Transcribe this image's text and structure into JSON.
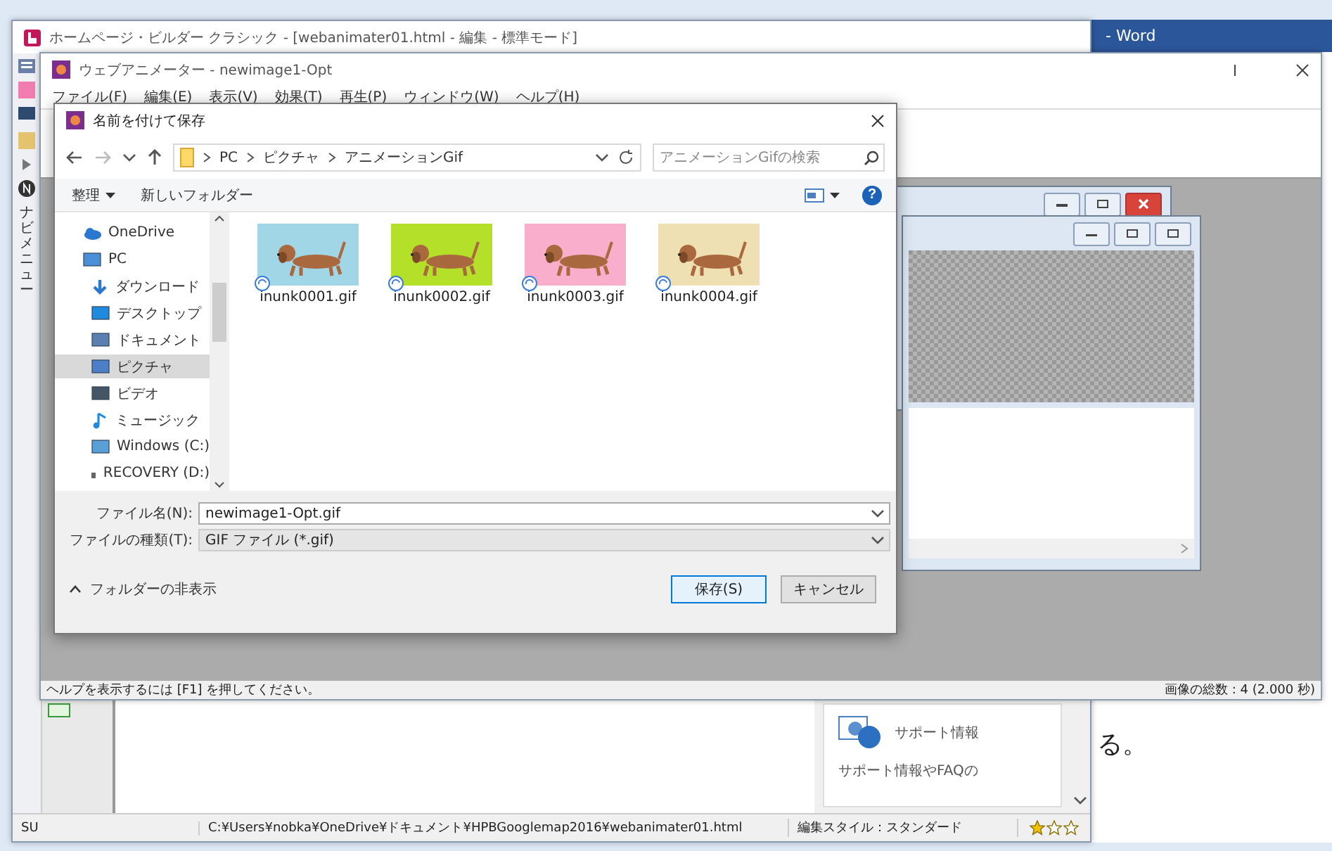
{
  "word_window": {
    "title": "- Word",
    "text": "る。"
  },
  "hpb_window": {
    "title": "ホームページ・ビルダー クラシック - [webanimater01.html - 編集 - 標準モード]",
    "nav_panel_label": "ナビメニュー",
    "support_card": {
      "title": "サポート情報",
      "text": "サポート情報やFAQの"
    },
    "status_bar": {
      "mode": "SU",
      "path": "C:¥Users¥nobka¥OneDrive¥ドキュメント¥HPBGooglemap2016¥webanimater01.html",
      "style": "編集スタイル：スタンダード",
      "stars": 1
    }
  },
  "animator_window": {
    "title": "ウェブアニメーター - newimage1-Opt",
    "menu": [
      "ファイル(F)",
      "編集(E)",
      "表示(V)",
      "効果(T)",
      "再生(P)",
      "ウィンドウ(W)",
      "ヘルプ(H)"
    ],
    "status_bar": {
      "help": "ヘルプを表示するには [F1] を押してください。",
      "count": "画像の総数 : 4 (2.000 秒)"
    }
  },
  "save_dialog": {
    "title": "名前を付けて保存",
    "breadcrumb": [
      "PC",
      "ピクチャ",
      "アニメーションGif"
    ],
    "search": {
      "placeholder": "アニメーションGifの検索"
    },
    "toolbar": {
      "organize": "整理",
      "new_folder": "新しいフォルダー",
      "help": "?"
    },
    "nav_items": [
      {
        "label": "OneDrive",
        "selected": false
      },
      {
        "label": "PC",
        "selected": false,
        "children": [
          {
            "label": "ダウンロード",
            "selected": false
          },
          {
            "label": "デスクトップ",
            "selected": false
          },
          {
            "label": "ドキュメント",
            "selected": false
          },
          {
            "label": "ピクチャ",
            "selected": true
          },
          {
            "label": "ビデオ",
            "selected": false
          },
          {
            "label": "ミュージック",
            "selected": false
          },
          {
            "label": "Windows (C:)",
            "selected": false
          },
          {
            "label": "RECOVERY (D:)",
            "selected": false
          }
        ]
      }
    ],
    "files": [
      {
        "name": "inunk0001.gif",
        "color": "#a0d6e6"
      },
      {
        "name": "inunk0002.gif",
        "color": "#b4e02a"
      },
      {
        "name": "inunk0003.gif",
        "color": "#f9afcb"
      },
      {
        "name": "inunk0004.gif",
        "color": "#eee0b2"
      }
    ],
    "filename": {
      "label": "ファイル名(N):",
      "value": "newimage1-Opt.gif"
    },
    "filetype": {
      "label": "ファイルの種類(T):",
      "value": "GIF ファイル (*.gif)"
    },
    "hide_folders": "フォルダーの非表示",
    "buttons": [
      {
        "label": "保存(S)",
        "kind": "primary"
      },
      {
        "label": "キャンセル",
        "kind": "secondary"
      }
    ]
  }
}
